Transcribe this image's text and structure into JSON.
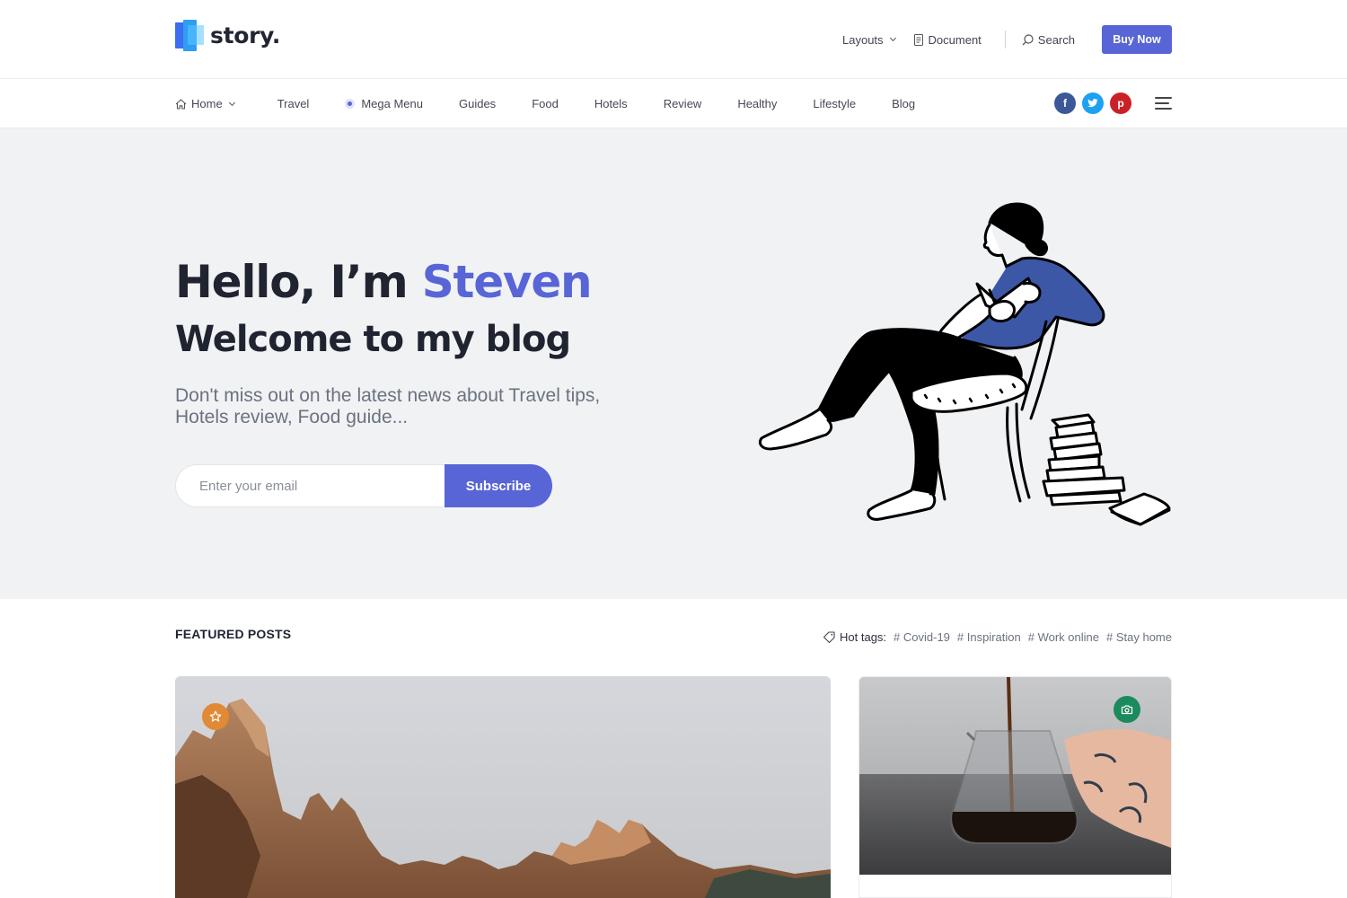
{
  "brand": {
    "name": "story."
  },
  "header": {
    "layouts_label": "Layouts",
    "document_label": "Document",
    "search_label": "Search",
    "buy_label": "Buy Now"
  },
  "nav": {
    "items": [
      {
        "label": "Home",
        "icon": "home-icon",
        "has_dropdown": true
      },
      {
        "label": "Travel"
      },
      {
        "label": "Mega Menu",
        "icon": "dot-icon"
      },
      {
        "label": "Guides"
      },
      {
        "label": "Food"
      },
      {
        "label": "Hotels"
      },
      {
        "label": "Review"
      },
      {
        "label": "Healthy"
      },
      {
        "label": "Lifestyle"
      },
      {
        "label": "Blog"
      }
    ],
    "socials": [
      {
        "name": "facebook",
        "glyph": "f"
      },
      {
        "name": "twitter",
        "glyph": "t"
      },
      {
        "name": "pinterest",
        "glyph": "p"
      }
    ]
  },
  "hero": {
    "greeting": "Hello, I’m ",
    "name": "Steven",
    "subtitle": "Welcome to my blog",
    "description": "Don't miss out on the latest news about Travel tips, Hotels review, Food guide...",
    "email_placeholder": "Enter your email",
    "subscribe_label": "Subscribe"
  },
  "featured": {
    "title": "FEATURED POSTS",
    "hot_tags_label": "Hot tags:",
    "tags": [
      "# Covid-19",
      "# Inspiration",
      "# Work online",
      "# Stay home"
    ]
  },
  "colors": {
    "accent": "#5865d6",
    "hero_bg": "#f1f2f4",
    "facebook": "#3b5998",
    "twitter": "#1da1f2",
    "pinterest": "#cb2027",
    "star_badge": "#e08a36",
    "camera_badge": "#1c8a5c"
  }
}
